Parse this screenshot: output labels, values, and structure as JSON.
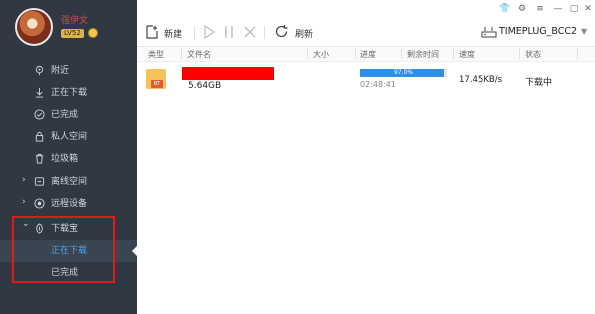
{
  "user": {
    "name": "强伊文",
    "level": "LV52"
  },
  "sidebar": {
    "items": [
      {
        "label": "附近",
        "icon": "location-icon"
      },
      {
        "label": "正在下载",
        "icon": "download-icon"
      },
      {
        "label": "已完成",
        "icon": "check-circle-icon"
      },
      {
        "label": "私人空间",
        "icon": "lock-icon"
      },
      {
        "label": "垃圾箱",
        "icon": "trash-icon"
      },
      {
        "label": "离线空间",
        "icon": "cloud-box-icon",
        "caret": "›"
      },
      {
        "label": "远程设备",
        "icon": "remote-device-icon",
        "caret": "›"
      },
      {
        "label": "下载宝",
        "icon": "download-treasure-icon",
        "caret": "⌄"
      }
    ],
    "sub_items": [
      {
        "label": "正在下载"
      },
      {
        "label": "已完成"
      }
    ]
  },
  "toolbar": {
    "new_label": "新建",
    "refresh_label": "刷新",
    "device_name": "TIMEPLUG_BCC2"
  },
  "table": {
    "columns": [
      "类型",
      "文件名",
      "大小",
      "进度",
      "剩余时间",
      "速度",
      "状态"
    ],
    "row": {
      "type_badge": "BT",
      "size": "5.64GB",
      "progress_text": "97.0%",
      "progress": 0.97,
      "elapsed": "02:48:41",
      "speed": "17.45KB/s",
      "status": "下载中"
    }
  },
  "colors": {
    "sidebar_bg": "#2f3843",
    "accent_blue": "#2f8fe6",
    "highlight_red": "#e01b1b",
    "redaction": "#ff0000"
  }
}
